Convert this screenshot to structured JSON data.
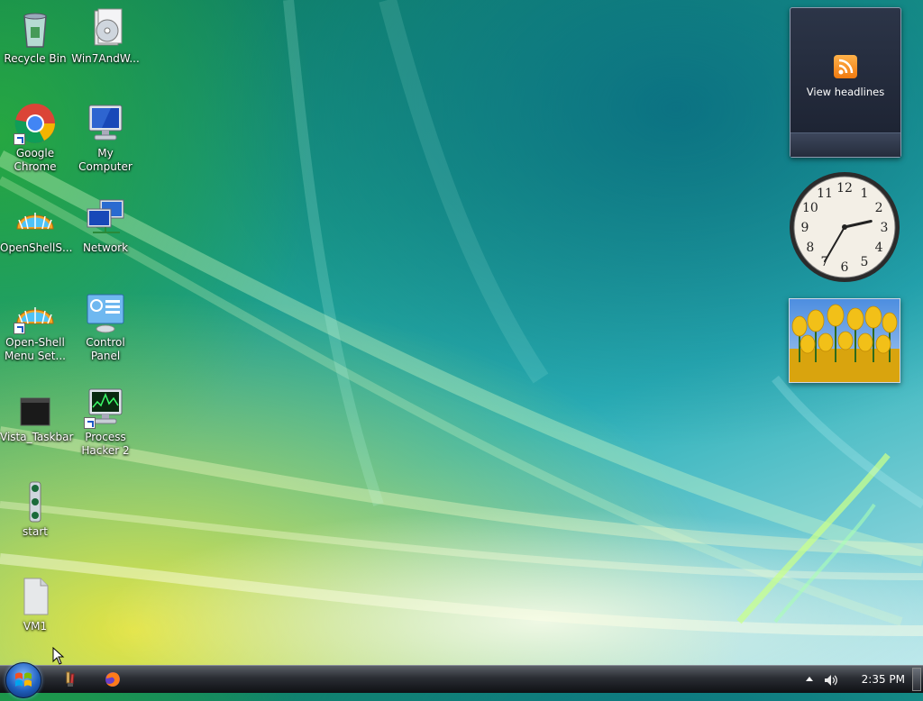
{
  "desktop_icons": [
    {
      "name": "recycle-bin",
      "label": "Recycle Bin"
    },
    {
      "name": "win7andw",
      "label": "Win7AndW..."
    },
    {
      "name": "google-chrome",
      "label": "Google Chrome"
    },
    {
      "name": "my-computer",
      "label": "My Computer"
    },
    {
      "name": "openshells",
      "label": "OpenShellS..."
    },
    {
      "name": "network",
      "label": "Network"
    },
    {
      "name": "open-shell-menu-settings",
      "label": "Open-Shell Menu Set..."
    },
    {
      "name": "control-panel",
      "label": "Control Panel"
    },
    {
      "name": "vista-taskbar",
      "label": "Vista_Taskbar"
    },
    {
      "name": "process-hacker-2",
      "label": "Process Hacker 2"
    },
    {
      "name": "start",
      "label": "start"
    },
    {
      "name": "vm1",
      "label": "VM1"
    }
  ],
  "gadgets": {
    "feed": {
      "label": "View headlines",
      "icon": "rss-icon"
    },
    "clock": {
      "numbers": [
        "12",
        "1",
        "2",
        "3",
        "4",
        "5",
        "6",
        "7",
        "8",
        "9",
        "10",
        "11"
      ],
      "time": "2:35"
    },
    "slideshow": {
      "subject": "tulips"
    }
  },
  "taskbar": {
    "start_icon": "windows-orb",
    "quick_launch": [
      "paint-icon",
      "firefox-icon"
    ],
    "tray_icons": [
      "show-hidden-icons-arrow",
      "volume-icon"
    ],
    "clock": "2:35 PM"
  },
  "colors": {
    "accent": "#1f5fbd",
    "rss": "#f07a10"
  }
}
